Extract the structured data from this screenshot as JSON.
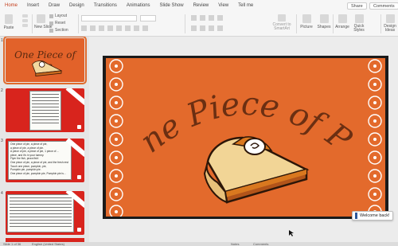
{
  "tabs": [
    "Home",
    "Insert",
    "Draw",
    "Design",
    "Transitions",
    "Animations",
    "Slide Show",
    "Review",
    "View",
    "Tell me"
  ],
  "share_label": "Share",
  "comments_label": "Comments",
  "ribbon": {
    "paste": "Paste",
    "new_slide": "New Slide",
    "layout": "Layout",
    "reset": "Reset",
    "section": "Section",
    "convert_smartart": "Convert to SmartArt",
    "picture": "Picture",
    "shapes": "Shapes",
    "arrange": "Arrange",
    "quick_styles": "Quick Styles",
    "design_ideas": "Design Ideas"
  },
  "slide_title": "One Piece of Pie",
  "slide_numbers": [
    "1",
    "2",
    "3",
    "4"
  ],
  "slide3_lines": [
    "One piece of pie, a piece of pie,",
    "a piece of pie, a piece of pie.",
    "A piece of pie, a piece of pie, 1 piece of ...",
    "piece, and it's in your tummy.",
    "Flyer the fish, pizza fish!",
    "One piece of pie, a piece of pie, and the fresh rest",
    "Touch one piece, pumpkin, pie,",
    "Pumpkin pie, pumpkin pie.",
    "One piece of pie, pumpkin pie, Pumpkin pie is..."
  ],
  "welcome": "Welcome back!",
  "status": {
    "slide": "Slide 1 of 36",
    "language": "English (United States)",
    "notes": "Notes",
    "comments": "Comments"
  },
  "colors": {
    "slide_orange": "#e36a2c",
    "title_brown": "#6b2f12",
    "accent": "#c43e1c"
  }
}
